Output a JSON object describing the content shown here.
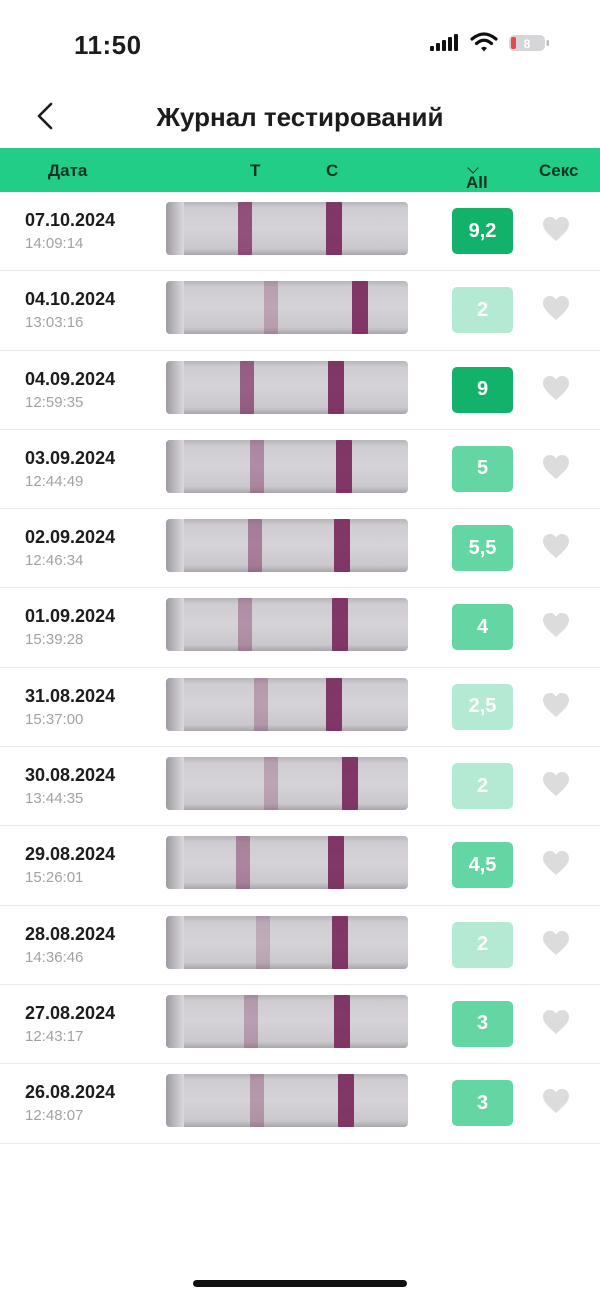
{
  "status_bar": {
    "time": "11:50",
    "battery_level": "8"
  },
  "header": {
    "title": "Журнал тестирований",
    "back_icon": "chevron-left-icon"
  },
  "columns": {
    "date": "Дата",
    "t": "T",
    "c": "C",
    "all": "All",
    "sex": "Секс"
  },
  "colors": {
    "header_band": "#22cd88",
    "score_high": "#12b26b",
    "score_mid": "#63d6a4",
    "score_low": "#b4ead3",
    "test_line": "#7a2a5c",
    "heart": "#dcdcdc"
  },
  "rows": [
    {
      "date": "07.10.2024",
      "time": "14:09:14",
      "score": "9,2",
      "level": "high",
      "t_intensity": 0.85
    },
    {
      "date": "04.10.2024",
      "time": "13:03:16",
      "score": "2",
      "level": "low",
      "t_intensity": 0.2
    },
    {
      "date": "04.09.2024",
      "time": "12:59:35",
      "score": "9",
      "level": "high",
      "t_intensity": 0.75
    },
    {
      "date": "03.09.2024",
      "time": "12:44:49",
      "score": "5",
      "level": "mid",
      "t_intensity": 0.4
    },
    {
      "date": "02.09.2024",
      "time": "12:46:34",
      "score": "5,5",
      "level": "mid",
      "t_intensity": 0.5
    },
    {
      "date": "01.09.2024",
      "time": "15:39:28",
      "score": "4",
      "level": "mid",
      "t_intensity": 0.35
    },
    {
      "date": "31.08.2024",
      "time": "15:37:00",
      "score": "2,5",
      "level": "low",
      "t_intensity": 0.25
    },
    {
      "date": "30.08.2024",
      "time": "13:44:35",
      "score": "2",
      "level": "low",
      "t_intensity": 0.2
    },
    {
      "date": "29.08.2024",
      "time": "15:26:01",
      "score": "4,5",
      "level": "mid",
      "t_intensity": 0.45
    },
    {
      "date": "28.08.2024",
      "time": "14:36:46",
      "score": "2",
      "level": "low",
      "t_intensity": 0.15
    },
    {
      "date": "27.08.2024",
      "time": "12:43:17",
      "score": "3",
      "level": "mid",
      "t_intensity": 0.25
    },
    {
      "date": "26.08.2024",
      "time": "12:48:07",
      "score": "3",
      "level": "mid",
      "t_intensity": 0.3
    }
  ]
}
